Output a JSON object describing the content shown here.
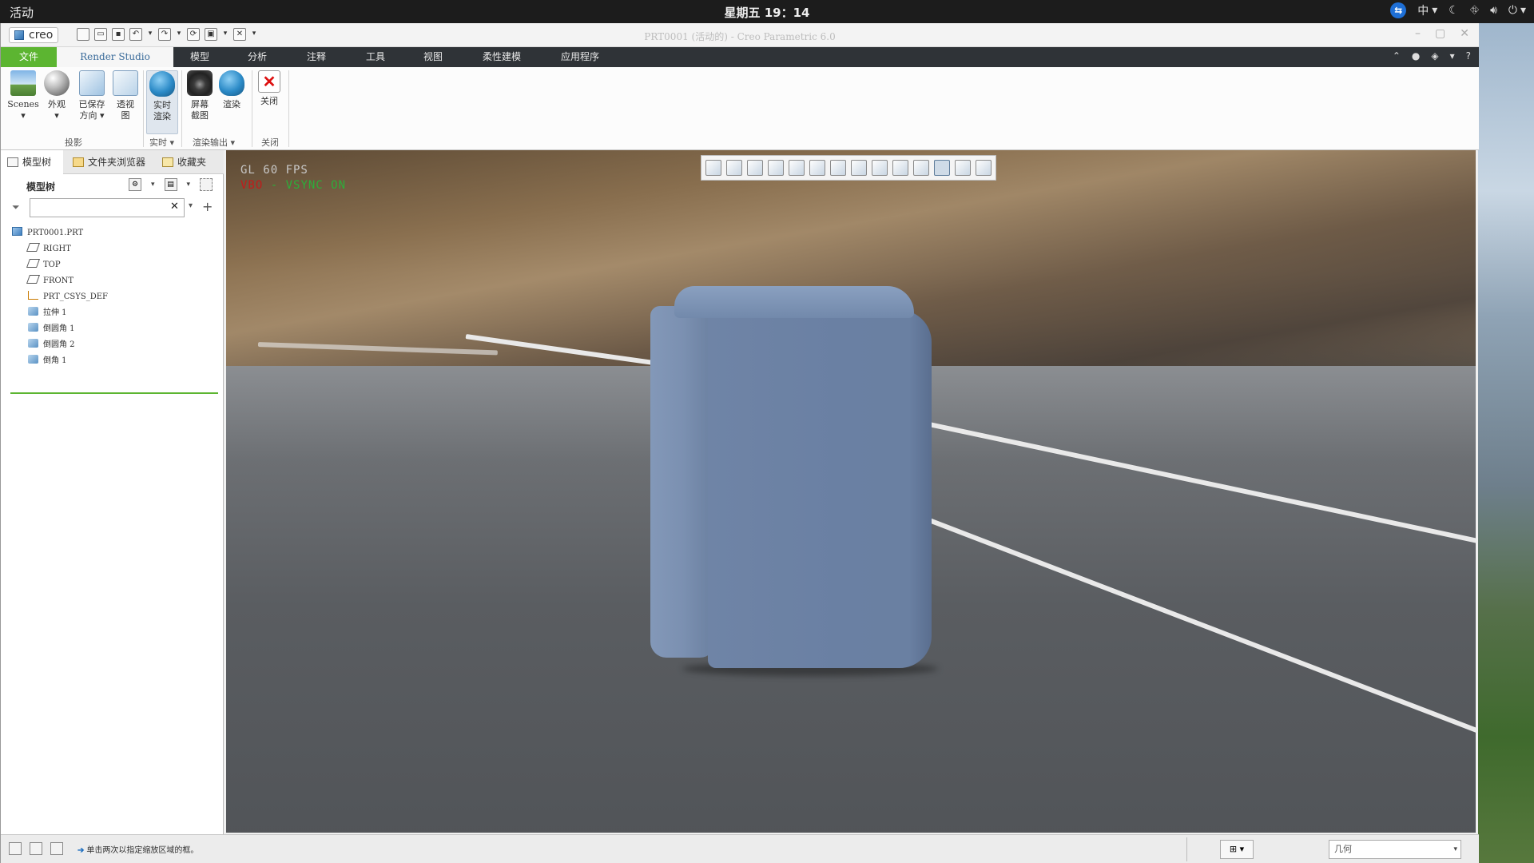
{
  "desktop": {
    "activities": "活动",
    "clock": "星期五 19：14",
    "input_method": "中"
  },
  "window": {
    "logo": "creo",
    "title": "PRT0001 (活动的) - Creo Parametric 6.0"
  },
  "menu": {
    "tabs": [
      "文件",
      "Render Studio",
      "模型",
      "分析",
      "注释",
      "工具",
      "视图",
      "柔性建模",
      "应用程序"
    ]
  },
  "ribbon": {
    "buttons": {
      "scenes": "Scenes",
      "appearance": "外观",
      "saved_orient_1": "已保存",
      "saved_orient_2": "方向",
      "perspective_1": "透视",
      "perspective_2": "图",
      "realtime_1": "实时",
      "realtime_2": "渲染",
      "screenshot_1": "屏幕",
      "screenshot_2": "截图",
      "render": "渲染",
      "close": "关闭"
    },
    "groups": {
      "projection": "投影",
      "realtime": "实时",
      "render_output": "渲染输出",
      "close": "关闭"
    }
  },
  "left_panel": {
    "tabs": [
      "模型树",
      "文件夹浏览器",
      "收藏夹"
    ],
    "header": "模型树",
    "search_value": "",
    "tree": [
      {
        "label": "PRT0001.PRT",
        "icon": "part-icon",
        "level": 0
      },
      {
        "label": "RIGHT",
        "icon": "datum-plane-icon",
        "level": 1
      },
      {
        "label": "TOP",
        "icon": "datum-plane-icon",
        "level": 1
      },
      {
        "label": "FRONT",
        "icon": "datum-plane-icon",
        "level": 1
      },
      {
        "label": "PRT_CSYS_DEF",
        "icon": "csys-icon",
        "level": 1
      },
      {
        "label": "拉伸 1",
        "icon": "extrude-icon",
        "level": 1
      },
      {
        "label": "倒圆角 1",
        "icon": "round-icon",
        "level": 1
      },
      {
        "label": "倒圆角 2",
        "icon": "round-icon",
        "level": 1
      },
      {
        "label": "倒角 1",
        "icon": "chamfer-icon",
        "level": 1
      }
    ]
  },
  "viewport": {
    "fps_line": "GL 60 FPS",
    "vsync_prefix": "VBO",
    "vsync_text": " - VSYNC ON"
  },
  "status": {
    "message": "单击两次以指定缩放区域的框。",
    "filter_value": "几何"
  },
  "colors": {
    "file_tab": "#5cb531",
    "menubar": "#2f3337",
    "model_color": "#6a80a3"
  }
}
